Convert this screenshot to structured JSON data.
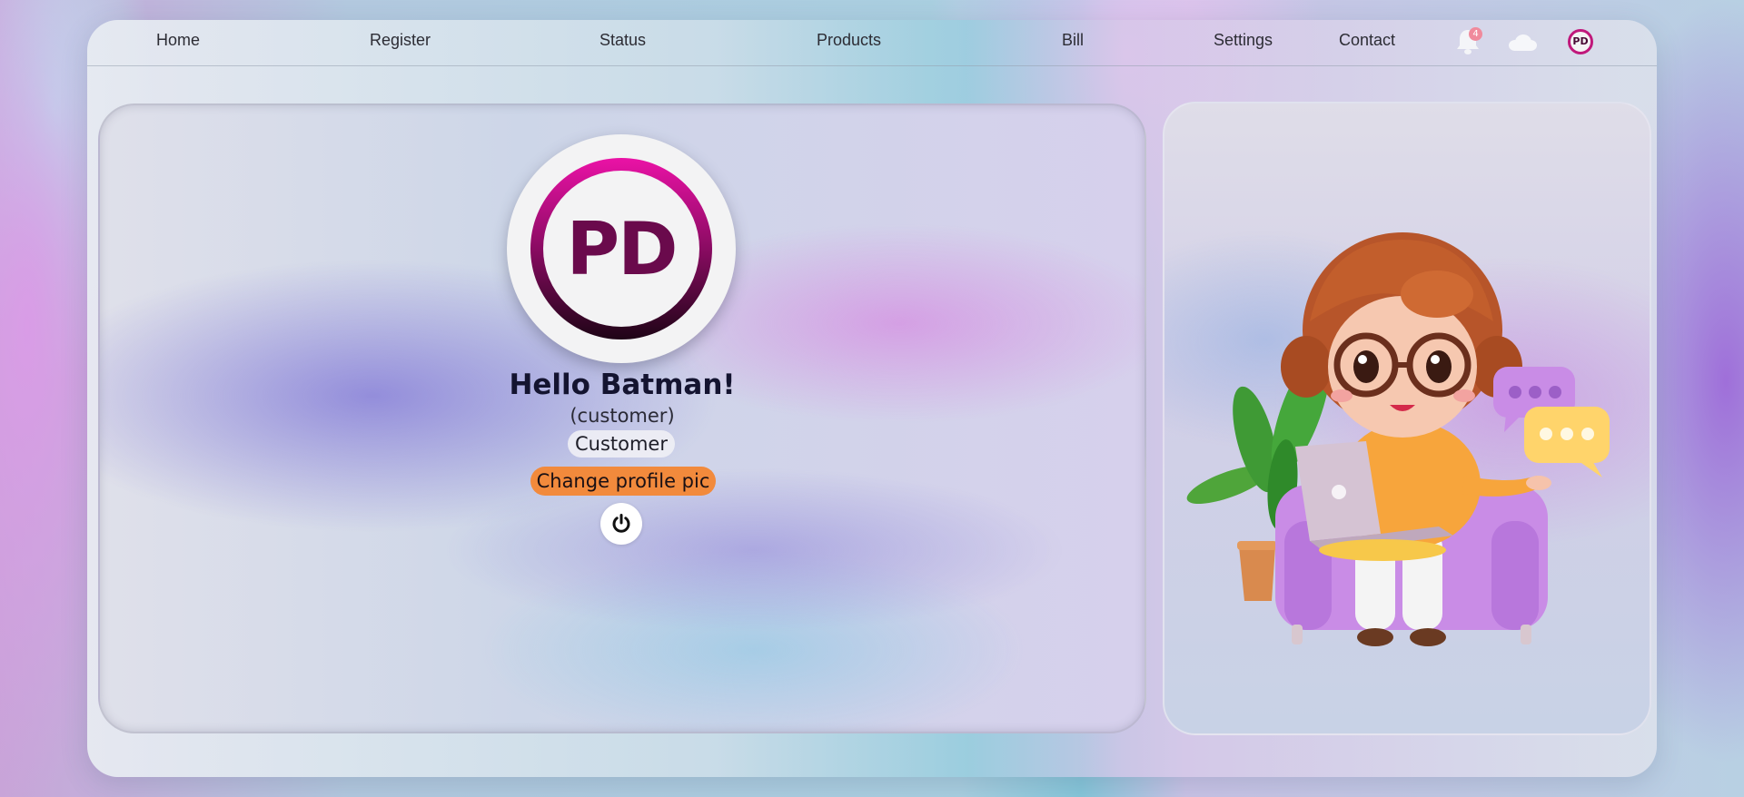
{
  "nav": {
    "items": [
      "Home",
      "Register",
      "Status",
      "Products",
      "Bill",
      "Settings",
      "Contact"
    ],
    "notification_count": "4",
    "avatar_initials": "PD"
  },
  "profile": {
    "pic_initials": "PD",
    "greeting": "Hello Batman!",
    "role_paren": "(customer)",
    "role_badge": "Customer",
    "change_pic_label": "Change profile pic"
  },
  "icons": {
    "notifications": "bell-icon",
    "cloud": "cloud-icon",
    "logout": "power-icon"
  },
  "colors": {
    "accent": "#f28a3c",
    "brand_pink": "#e8149f",
    "brand_dark": "#1e0416",
    "badge": "#f08a9c"
  }
}
